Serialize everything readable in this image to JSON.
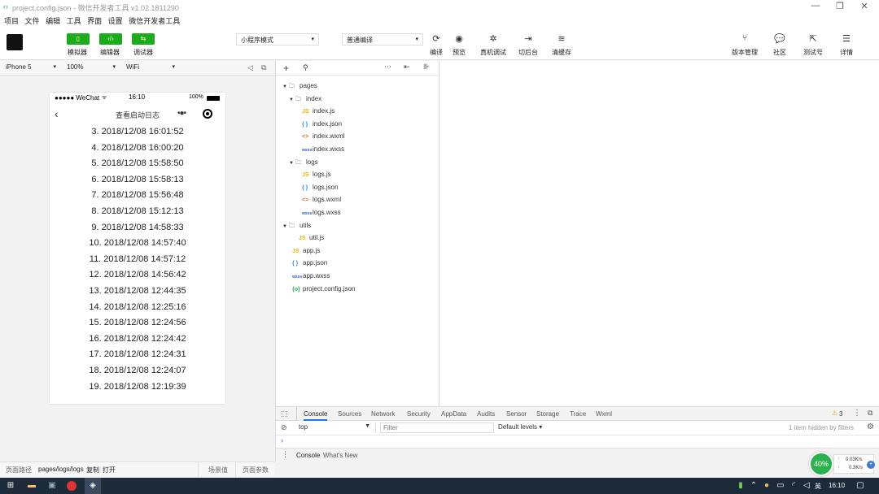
{
  "window": {
    "title": "project.config.json - 微信开发者工具 v1.02.1811290",
    "controls": [
      "—",
      "❐",
      "✕"
    ]
  },
  "menu": [
    "项目",
    "文件",
    "编辑",
    "工具",
    "界面",
    "设置",
    "微信开发者工具"
  ],
  "toolbar": {
    "left_buttons": [
      {
        "label": "模拟器",
        "icon": "phone-icon"
      },
      {
        "label": "编辑器",
        "icon": "code-icon"
      },
      {
        "label": "调试器",
        "icon": "debug-icon"
      }
    ],
    "mode_select": "小程序模式",
    "compile_select": "普通编译",
    "mid_buttons": [
      {
        "label": "编译",
        "glyph": "⟳"
      },
      {
        "label": "预览",
        "glyph": "◉"
      },
      {
        "label": "真机调试",
        "glyph": "✲"
      },
      {
        "label": "切后台",
        "glyph": "⇥"
      },
      {
        "label": "清缓存",
        "glyph": "≋"
      }
    ],
    "right_buttons": [
      {
        "label": "版本管理",
        "glyph": "⑂"
      },
      {
        "label": "社区",
        "glyph": "💬"
      },
      {
        "label": "测试号",
        "glyph": "⇱"
      },
      {
        "label": "详情",
        "glyph": "☰"
      }
    ]
  },
  "device": {
    "model": "iPhone 5",
    "zoom": "100%",
    "network": "WiFi"
  },
  "phone": {
    "carrier": "●●●●● WeChat",
    "time": "16:10",
    "battery": "100%",
    "nav_title": "查看启动日志",
    "logs": [
      "3. 2018/12/08 16:01:52",
      "4. 2018/12/08 16:00:20",
      "5. 2018/12/08 15:58:50",
      "6. 2018/12/08 15:58:13",
      "7. 2018/12/08 15:56:48",
      "8. 2018/12/08 15:12:13",
      "9. 2018/12/08 14:58:33",
      "10. 2018/12/08 14:57:40",
      "11. 2018/12/08 14:57:12",
      "12. 2018/12/08 14:56:42",
      "13. 2018/12/08 12:44:35",
      "14. 2018/12/08 12:25:16",
      "15. 2018/12/08 12:24:56",
      "16. 2018/12/08 12:24:42",
      "17. 2018/12/08 12:24:31",
      "18. 2018/12/08 12:24:07",
      "19. 2018/12/08 12:19:39"
    ]
  },
  "sim_footer": {
    "path_label": "页面路径",
    "path": "pages/logs/logs",
    "copy": "复制",
    "open": "打开",
    "scene": "场景值",
    "params": "页面参数"
  },
  "tree": [
    {
      "type": "folder",
      "name": "pages",
      "depth": 0,
      "open": true
    },
    {
      "type": "folder",
      "name": "index",
      "depth": 1,
      "open": true
    },
    {
      "type": "js",
      "name": "index.js",
      "depth": 2
    },
    {
      "type": "json",
      "name": "index.json",
      "depth": 2
    },
    {
      "type": "wxml",
      "name": "index.wxml",
      "depth": 2
    },
    {
      "type": "wxss",
      "name": "index.wxss",
      "depth": 2
    },
    {
      "type": "folder",
      "name": "logs",
      "depth": 1,
      "open": true
    },
    {
      "type": "js",
      "name": "logs.js",
      "depth": 2
    },
    {
      "type": "json",
      "name": "logs.json",
      "depth": 2
    },
    {
      "type": "wxml",
      "name": "logs.wxml",
      "depth": 2
    },
    {
      "type": "wxss",
      "name": "logs.wxss",
      "depth": 2
    },
    {
      "type": "folder",
      "name": "utils",
      "depth": 0,
      "open": true
    },
    {
      "type": "js",
      "name": "util.js",
      "depth": 1.5
    },
    {
      "type": "js",
      "name": "app.js",
      "depth": 0.5
    },
    {
      "type": "json",
      "name": "app.json",
      "depth": 0.5
    },
    {
      "type": "wxss",
      "name": "app.wxss",
      "depth": 0.5
    },
    {
      "type": "cfg",
      "name": "project.config.json",
      "depth": 0.5
    }
  ],
  "devtools": {
    "tabs": [
      "Console",
      "Sources",
      "Network",
      "Security",
      "AppData",
      "Audits",
      "Sensor",
      "Storage",
      "Trace",
      "Wxml"
    ],
    "active_tab": "Console",
    "warnings": "3",
    "context": "top",
    "filter_placeholder": "Filter",
    "levels": "Default levels ▾",
    "hidden": "1 item hidden by filters",
    "drawer_tabs": [
      "Console",
      "What's New"
    ]
  },
  "netwidget": {
    "percent": "40%",
    "up": "0.03K/s",
    "down": "0.3K/s"
  },
  "taskbar": {
    "time": "16:10",
    "ime": "英"
  }
}
